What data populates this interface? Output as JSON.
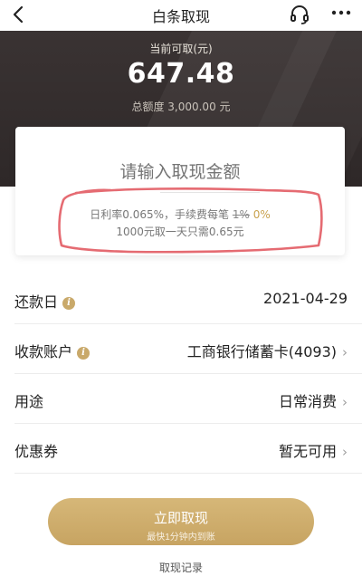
{
  "nav": {
    "title": "白条取现"
  },
  "summary": {
    "caption": "当前可取(元)",
    "amount": "647.48",
    "total_line": "总额度 3,000.00 元"
  },
  "withdraw_card": {
    "input_placeholder": "请输入取现金额",
    "rate_text": "日利率0.065%，手续费每笔 ",
    "fee_old": "1%",
    "fee_new": " 0%",
    "example_text": "1000元取一天只需0.65元"
  },
  "rows": {
    "repay_day": {
      "label": "还款日",
      "value": "2021-04-29"
    },
    "account": {
      "label": "收款账户",
      "value": "工商银行储蓄卡(4093)"
    },
    "purpose": {
      "label": "用途",
      "value": "日常消费"
    },
    "coupon": {
      "label": "优惠券",
      "value": "暂无可用"
    }
  },
  "info_glyph": "i",
  "chevron_glyph": "›",
  "button": {
    "label": "立即取现",
    "sublabel": "最快1分钟内到账"
  },
  "record_link": "取现记录",
  "colors": {
    "gold": "#c9a24e",
    "button": "#d0ad6c",
    "hero_bg": "#332d2d",
    "annotation": "#e56b72"
  }
}
